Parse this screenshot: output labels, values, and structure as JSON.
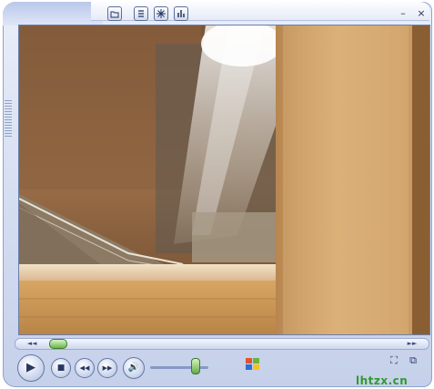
{
  "window": {
    "toolbar_icons": [
      "folder-icon",
      "list-icon",
      "visualization-icon",
      "equalizer-icon"
    ],
    "minimize_glyph": "–",
    "close_glyph": "×"
  },
  "video": {
    "description_colors": {
      "stone": "#c8a072",
      "light": "#f3f0e6",
      "shadow": "#4a3422"
    }
  },
  "seekbar": {
    "left_glyph": "◄◄",
    "right_glyph": "►►",
    "position_fraction": 0.08
  },
  "controls": {
    "play_glyph": "▶",
    "stop_glyph": "■",
    "previous_glyph": "◀◀",
    "next_glyph": "▶▶",
    "mute_glyph": "🔊",
    "volume_fraction": 0.75,
    "fullscreen_glyph": "⛶",
    "compact_glyph": "⧉"
  },
  "watermark": "lhtzx.cn",
  "colors": {
    "accent": "#5d73a8",
    "brand_text": "#2f9a2f"
  }
}
